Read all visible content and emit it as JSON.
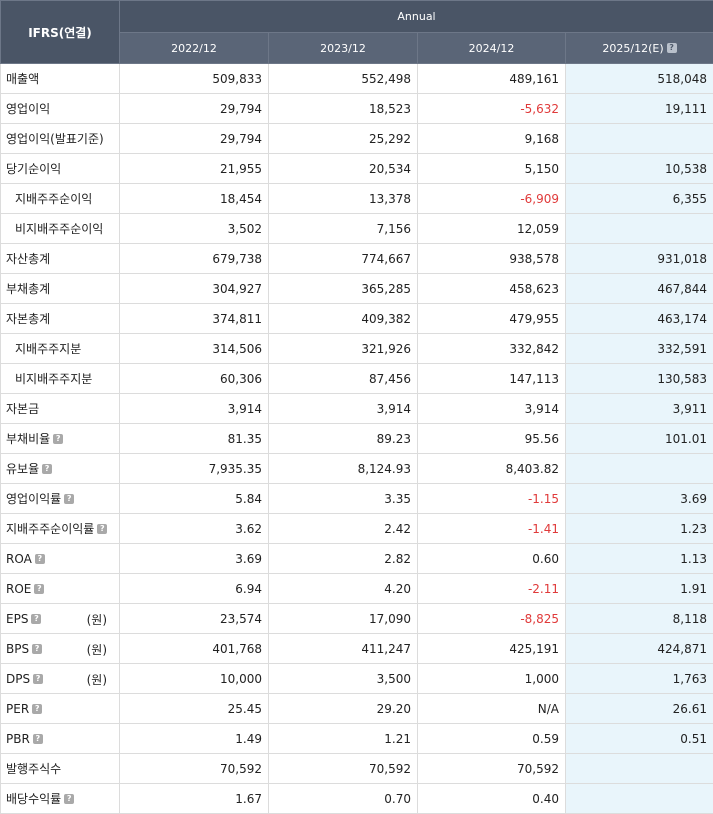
{
  "header": {
    "corner": "IFRS(연결)",
    "annual": "Annual",
    "years": [
      "2022/12",
      "2023/12",
      "2024/12",
      "2025/12(E)"
    ],
    "help_glyph": "?"
  },
  "rows": [
    {
      "label": "매출액",
      "indent": false,
      "help": false,
      "unit": "",
      "values": [
        "509,833",
        "552,498",
        "489,161",
        "518,048"
      ]
    },
    {
      "label": "영업이익",
      "indent": false,
      "help": false,
      "unit": "",
      "values": [
        "29,794",
        "18,523",
        "-5,632",
        "19,111"
      ]
    },
    {
      "label": "영업이익(발표기준)",
      "indent": false,
      "help": false,
      "unit": "",
      "values": [
        "29,794",
        "25,292",
        "9,168",
        ""
      ]
    },
    {
      "label": "당기순이익",
      "indent": false,
      "help": false,
      "unit": "",
      "values": [
        "21,955",
        "20,534",
        "5,150",
        "10,538"
      ]
    },
    {
      "label": "지배주주순이익",
      "indent": true,
      "help": false,
      "unit": "",
      "values": [
        "18,454",
        "13,378",
        "-6,909",
        "6,355"
      ]
    },
    {
      "label": "비지배주주순이익",
      "indent": true,
      "help": false,
      "unit": "",
      "values": [
        "3,502",
        "7,156",
        "12,059",
        ""
      ]
    },
    {
      "label": "자산총계",
      "indent": false,
      "help": false,
      "unit": "",
      "values": [
        "679,738",
        "774,667",
        "938,578",
        "931,018"
      ]
    },
    {
      "label": "부채총계",
      "indent": false,
      "help": false,
      "unit": "",
      "values": [
        "304,927",
        "365,285",
        "458,623",
        "467,844"
      ]
    },
    {
      "label": "자본총계",
      "indent": false,
      "help": false,
      "unit": "",
      "values": [
        "374,811",
        "409,382",
        "479,955",
        "463,174"
      ]
    },
    {
      "label": "지배주주지분",
      "indent": true,
      "help": false,
      "unit": "",
      "values": [
        "314,506",
        "321,926",
        "332,842",
        "332,591"
      ]
    },
    {
      "label": "비지배주주지분",
      "indent": true,
      "help": false,
      "unit": "",
      "values": [
        "60,306",
        "87,456",
        "147,113",
        "130,583"
      ]
    },
    {
      "label": "자본금",
      "indent": false,
      "help": false,
      "unit": "",
      "values": [
        "3,914",
        "3,914",
        "3,914",
        "3,911"
      ]
    },
    {
      "label": "부채비율",
      "indent": false,
      "help": true,
      "unit": "",
      "values": [
        "81.35",
        "89.23",
        "95.56",
        "101.01"
      ]
    },
    {
      "label": "유보율",
      "indent": false,
      "help": true,
      "unit": "",
      "values": [
        "7,935.35",
        "8,124.93",
        "8,403.82",
        ""
      ]
    },
    {
      "label": "영업이익률",
      "indent": false,
      "help": true,
      "unit": "",
      "values": [
        "5.84",
        "3.35",
        "-1.15",
        "3.69"
      ]
    },
    {
      "label": "지배주주순이익률",
      "indent": false,
      "help": true,
      "unit": "",
      "values": [
        "3.62",
        "2.42",
        "-1.41",
        "1.23"
      ]
    },
    {
      "label": "ROA",
      "indent": false,
      "help": true,
      "unit": "",
      "values": [
        "3.69",
        "2.82",
        "0.60",
        "1.13"
      ]
    },
    {
      "label": "ROE",
      "indent": false,
      "help": true,
      "unit": "",
      "values": [
        "6.94",
        "4.20",
        "-2.11",
        "1.91"
      ]
    },
    {
      "label": "EPS",
      "indent": false,
      "help": true,
      "unit": "(원)",
      "values": [
        "23,574",
        "17,090",
        "-8,825",
        "8,118"
      ]
    },
    {
      "label": "BPS",
      "indent": false,
      "help": true,
      "unit": "(원)",
      "values": [
        "401,768",
        "411,247",
        "425,191",
        "424,871"
      ]
    },
    {
      "label": "DPS",
      "indent": false,
      "help": true,
      "unit": "(원)",
      "values": [
        "10,000",
        "3,500",
        "1,000",
        "1,763"
      ]
    },
    {
      "label": "PER",
      "indent": false,
      "help": true,
      "unit": "",
      "values": [
        "25.45",
        "29.20",
        "N/A",
        "26.61"
      ]
    },
    {
      "label": "PBR",
      "indent": false,
      "help": true,
      "unit": "",
      "values": [
        "1.49",
        "1.21",
        "0.59",
        "0.51"
      ]
    },
    {
      "label": "발행주식수",
      "indent": false,
      "help": false,
      "unit": "",
      "values": [
        "70,592",
        "70,592",
        "70,592",
        ""
      ]
    },
    {
      "label": "배당수익률",
      "indent": false,
      "help": true,
      "unit": "",
      "values": [
        "1.67",
        "0.70",
        "0.40",
        ""
      ]
    }
  ],
  "colors": {
    "header_bg": "#4f5a6b",
    "estimate_bg": "#e9f5fb",
    "negative": "#e03a3a"
  }
}
